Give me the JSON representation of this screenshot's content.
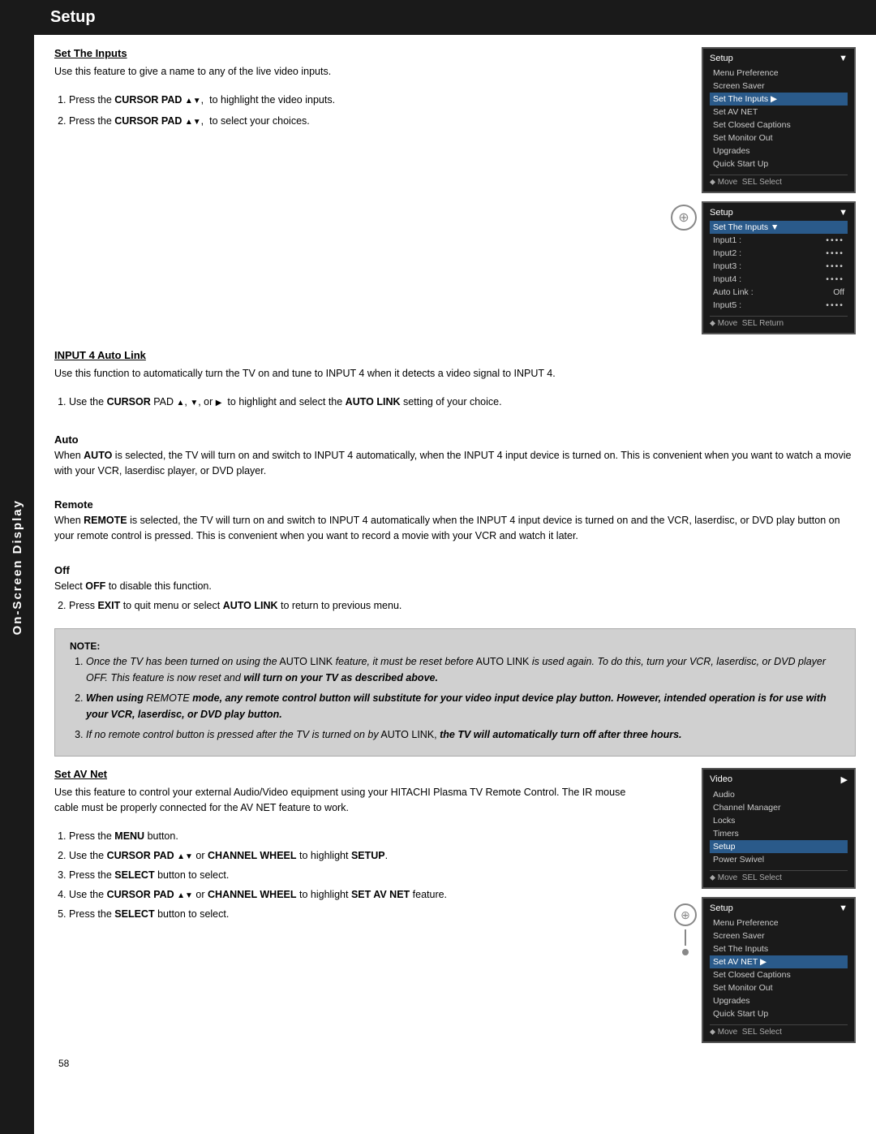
{
  "sidebar": {
    "label": "On-Screen Display"
  },
  "header": {
    "title": "Setup"
  },
  "sections": {
    "setTheInputs": {
      "title": "Set The Inputs",
      "intro": "Use this feature to give a name to any of the live video inputs.",
      "steps": [
        "Press the <b>CURSOR PAD</b> ▲, ▼  to highlight the video inputs.",
        "Press the <b>CURSOR PAD</b> ▲, ▼  to select your choices."
      ],
      "menu1": {
        "title": "Setup",
        "items": [
          "Menu Preference",
          "Screen Saver",
          "Set The Inputs",
          "Set AV NET",
          "Set Closed Captions",
          "Set Monitor Out",
          "Upgrades",
          "Quick Start Up"
        ],
        "highlighted": "Set The Inputs",
        "footer": "↕ Move  SEL Select"
      },
      "menu2": {
        "title": "Setup",
        "subtitle": "Set The Inputs",
        "rows": [
          {
            "label": "Input1",
            "value": "••••"
          },
          {
            "label": "Input2",
            "value": "••••"
          },
          {
            "label": "Input3",
            "value": "••••"
          },
          {
            "label": "Input4",
            "value": "••••"
          },
          {
            "label": "Auto Link",
            "value": "Off"
          },
          {
            "label": "Input5",
            "value": "••••"
          }
        ],
        "footer": "↕ Move  SEL Return"
      }
    },
    "input4AutoLink": {
      "title": "INPUT 4 Auto Link",
      "intro": "Use this function to automatically turn the TV on and tune to INPUT 4 when it detects a video signal to INPUT 4.",
      "step1": "Use the <b>CURSOR</b> PAD ▲, ▼, or ►  to highlight and select the <b>AUTO LINK</b> setting of your choice.",
      "subsections": {
        "auto": {
          "title": "Auto",
          "text": "When <b>AUTO</b> is selected, the TV will turn on and switch to INPUT 4 automatically, when the INPUT 4 input device is turned on. This is convenient when you want to watch a movie with your VCR, laserdisc player, or DVD player."
        },
        "remote": {
          "title": "Remote",
          "text": "When <b>REMOTE</b> is selected, the TV will turn on and switch to INPUT 4 automatically when the INPUT 4 input device is turned on and the VCR, laserdisc, or DVD play button on your remote control is pressed. This is convenient when you want to record a movie with your VCR and watch it later."
        },
        "off": {
          "title": "Off",
          "text1": "Select <b>OFF</b> to disable this function.",
          "text2": "Press <b>EXIT</b> to quit menu or select <b>AUTO LINK</b> to return to previous menu."
        }
      }
    },
    "noteBox": {
      "noteLabel": "NOTE:",
      "items": [
        "Once the TV has been turned on using the AUTO LINK feature, it must be reset before AUTO LINK is used again. To do this, turn your VCR, laserdisc, or DVD player OFF. This feature is now reset and will turn on your TV as described above.",
        "When using REMOTE mode, any remote control button will substitute for your video input device play button. However, intended operation is for use with your VCR, laserdisc, or DVD play button.",
        "If no remote control button is pressed after the TV is turned on by AUTO LINK, the TV will automatically turn off after three hours."
      ]
    },
    "setAVNet": {
      "title": "Set AV Net",
      "intro": "Use this feature to control your external Audio/Video equipment using your HITACHI Plasma TV Remote Control.  The IR mouse cable must be properly connected for the AV NET feature to work.",
      "steps": [
        "Press the <b>MENU</b> button.",
        "Use the <b>CURSOR PAD</b> ▲▼ or <b>CHANNEL WHEEL</b> to highlight <b>SETUP</b>.",
        "Press the <b>SELECT</b> button to select.",
        "Use the <b>CURSOR PAD</b> ▲▼ or <b>CHANNEL WHEEL</b> to highlight <b>SET AV NET</b> feature.",
        "Press the <b>SELECT</b> button to select."
      ],
      "menu3": {
        "title": "Video",
        "items": [
          "Audio",
          "Channel Manager",
          "Locks",
          "Timers",
          "Setup",
          "Power Swivel"
        ],
        "highlighted": "Setup",
        "footer": "↕ Move  SEL Select"
      },
      "menu4": {
        "title": "Setup",
        "items": [
          "Menu Preference",
          "Screen Saver",
          "Set The Inputs",
          "Set AV NET",
          "Set Closed Captions",
          "Set Monitor Out",
          "Upgrades",
          "Quick Start Up"
        ],
        "highlighted": "Set AV NET",
        "footer": "↕ Move  SEL Select"
      }
    }
  },
  "pageNumber": "58"
}
